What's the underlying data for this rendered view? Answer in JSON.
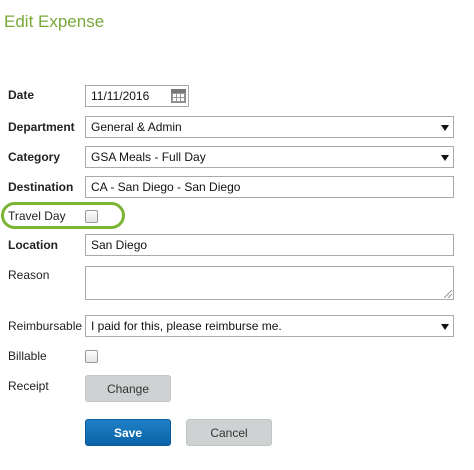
{
  "page": {
    "title": "Edit Expense"
  },
  "form": {
    "date": {
      "label": "Date",
      "value": "11/11/2016"
    },
    "department": {
      "label": "Department",
      "value": "General & Admin"
    },
    "category": {
      "label": "Category",
      "value": "GSA Meals - Full Day"
    },
    "destination": {
      "label": "Destination",
      "value": "CA - San Diego - San Diego"
    },
    "travel_day": {
      "label": "Travel Day",
      "checked": false
    },
    "location": {
      "label": "Location",
      "value": "San Diego"
    },
    "reason": {
      "label": "Reason",
      "value": ""
    },
    "reimbursable": {
      "label": "Reimbursable",
      "value": "I paid for this, please reimburse me."
    },
    "billable": {
      "label": "Billable",
      "checked": false
    },
    "receipt": {
      "label": "Receipt",
      "button_label": "Change"
    }
  },
  "actions": {
    "save_label": "Save",
    "cancel_label": "Cancel"
  },
  "colors": {
    "accent": "#7aa83a",
    "highlight": "#7ab536",
    "primary_button": "#1a74ba"
  }
}
